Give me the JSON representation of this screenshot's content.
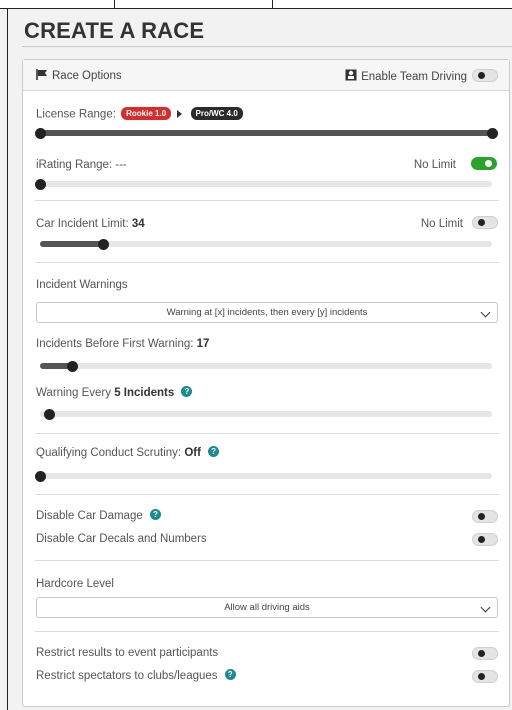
{
  "page": {
    "title": "CREATE A RACE"
  },
  "panel": {
    "header": {
      "label": "Race Options",
      "team_label": "Enable Team Driving",
      "team_on": false
    }
  },
  "license": {
    "label": "License Range:",
    "min_badge": "Rookie 1.0",
    "max_badge": "Pro/WC 4.0",
    "min_pct": 0,
    "max_pct": 100
  },
  "irating": {
    "label": "iRating Range: ---",
    "nolimit_label": "No Limit",
    "nolimit_on": true,
    "value_pct": 0
  },
  "incident_limit": {
    "label": "Car Incident Limit:",
    "value": "34",
    "nolimit_label": "No Limit",
    "nolimit_on": false,
    "value_pct": 14
  },
  "incident_warnings": {
    "label": "Incident Warnings",
    "selected": "Warning at [x] incidents, then every [y] incidents"
  },
  "before_first": {
    "label": "Incidents Before First Warning:",
    "value": "17",
    "value_pct": 7
  },
  "warning_every": {
    "label_prefix": "Warning Every",
    "value": "5 Incidents",
    "value_pct": 2
  },
  "qualifying": {
    "label": "Qualifying Conduct Scrutiny:",
    "value": "Off",
    "value_pct": 0
  },
  "damage": {
    "disable_damage": "Disable Car Damage",
    "disable_decals": "Disable Car Decals and Numbers",
    "damage_on": false,
    "decals_on": false
  },
  "hardcore": {
    "label": "Hardcore Level",
    "selected": "Allow all driving aids"
  },
  "restrict": {
    "results": "Restrict results to event participants",
    "spectators": "Restrict spectators to clubs/leagues",
    "results_on": false,
    "spectators_on": false
  },
  "icons": {
    "flag": "flag-icon",
    "team": "team-driving-icon",
    "help": "help-icon",
    "chevron": "chevron-down-icon"
  },
  "colors": {
    "accent_green": "#2aa32a",
    "help_teal": "#1a8b93",
    "badge_red": "#d92b2b",
    "badge_dark": "#2b2b2b"
  }
}
